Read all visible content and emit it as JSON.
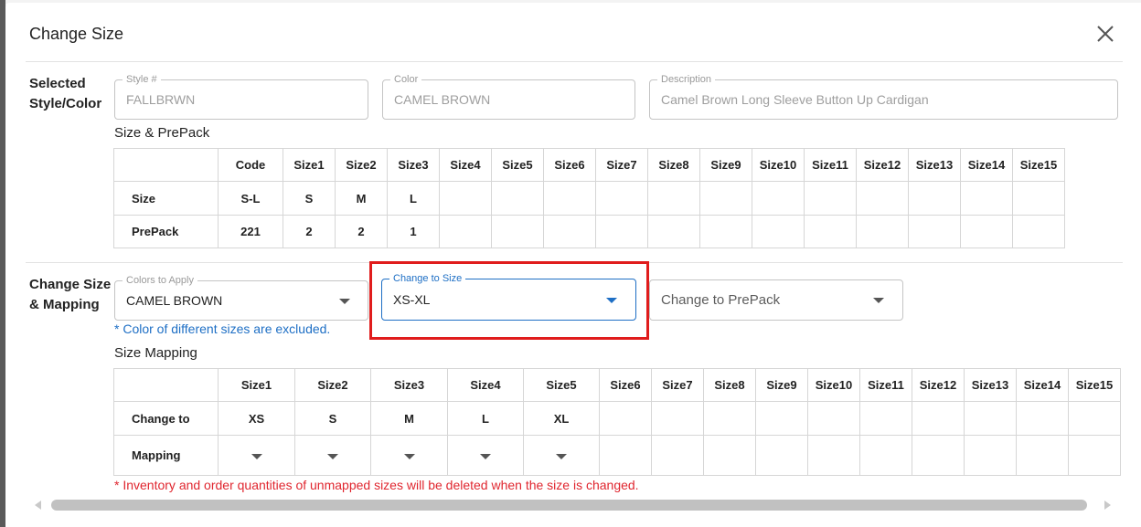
{
  "dialog": {
    "title": "Change Size"
  },
  "selected": {
    "label": [
      "Selected",
      "Style/Color"
    ],
    "style": {
      "legend": "Style #",
      "value": "FALLBRWN"
    },
    "color": {
      "legend": "Color",
      "value": "CAMEL BROWN"
    },
    "description": {
      "legend": "Description",
      "value": "Camel Brown Long Sleeve Button Up Cardigan"
    }
  },
  "size_prepack": {
    "title": "Size & PrePack",
    "headers": [
      "",
      "Code",
      "Size1",
      "Size2",
      "Size3",
      "Size4",
      "Size5",
      "Size6",
      "Size7",
      "Size8",
      "Size9",
      "Size10",
      "Size11",
      "Size12",
      "Size13",
      "Size14",
      "Size15"
    ],
    "rows": [
      {
        "label": "Size",
        "cells": [
          "S-L",
          "S",
          "M",
          "L",
          "",
          "",
          "",
          "",
          "",
          "",
          "",
          "",
          "",
          "",
          "",
          ""
        ]
      },
      {
        "label": "PrePack",
        "cells": [
          "221",
          "2",
          "2",
          "1",
          "",
          "",
          "",
          "",
          "",
          "",
          "",
          "",
          "",
          "",
          "",
          ""
        ]
      }
    ]
  },
  "change": {
    "label": [
      "Change Size",
      "& Mapping"
    ],
    "colors_to_apply": {
      "legend": "Colors to Apply",
      "value": "CAMEL BROWN"
    },
    "change_to_size": {
      "legend": "Change to Size",
      "value": "XS-XL"
    },
    "change_to_prepack": {
      "placeholder": "Change to PrePack"
    },
    "note": "* Color of different sizes are excluded.",
    "mapping_title": "Size Mapping",
    "mapping_headers": [
      "",
      "Size1",
      "Size2",
      "Size3",
      "Size4",
      "Size5",
      "Size6",
      "Size7",
      "Size8",
      "Size9",
      "Size10",
      "Size11",
      "Size12",
      "Size13",
      "Size14",
      "Size15"
    ],
    "change_to_row": {
      "label": "Change to",
      "cells": [
        "XS",
        "S",
        "M",
        "L",
        "XL",
        "",
        "",
        "",
        "",
        "",
        "",
        "",
        "",
        "",
        ""
      ]
    },
    "mapping_row": {
      "label": "Mapping",
      "dropdown_count": 5,
      "total_cells": 15
    },
    "warning": "* Inventory and order quantities of unmapped sizes will be deleted when the size is changed."
  },
  "colors": {
    "accent": "#1e6fc5",
    "warning": "#e0262f",
    "highlight": "#e01c1c"
  }
}
